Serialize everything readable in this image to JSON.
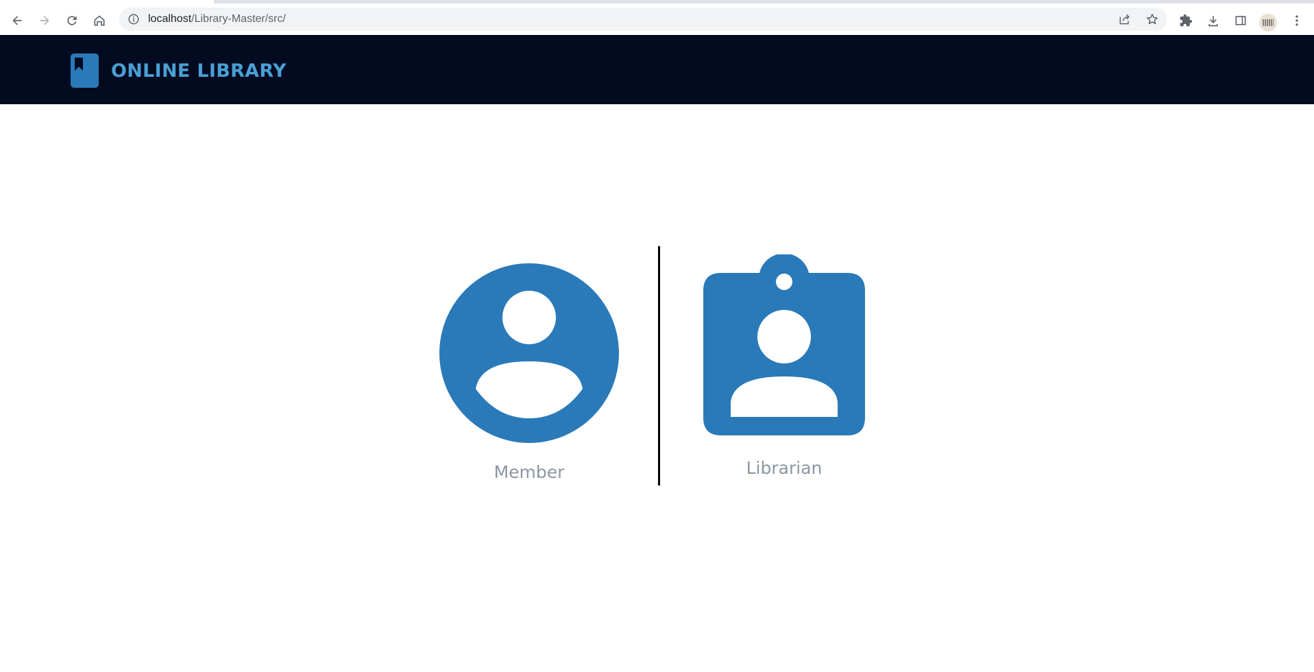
{
  "browser": {
    "url_host": "localhost",
    "url_path": "/Library-Master/src/",
    "icons": {
      "back": "arrow-left-icon",
      "forward": "arrow-right-icon",
      "reload": "reload-icon",
      "home": "home-icon",
      "site_info": "info-icon",
      "share": "share-icon",
      "bookmark": "star-icon",
      "extensions": "puzzle-icon",
      "downloads": "download-icon",
      "side_panel": "side-panel-icon",
      "menu": "kebab-menu-icon"
    }
  },
  "header": {
    "brand_name": "ONLINE LIBRARY",
    "logo_icon": "book-icon",
    "background": "#020b20",
    "brand_color": "#4a9fd4"
  },
  "roles": [
    {
      "label": "Member",
      "icon": "user-circle-icon"
    },
    {
      "label": "Librarian",
      "icon": "id-badge-icon"
    }
  ],
  "colors": {
    "accent": "#2a7ab9",
    "label": "#8a96a3"
  }
}
